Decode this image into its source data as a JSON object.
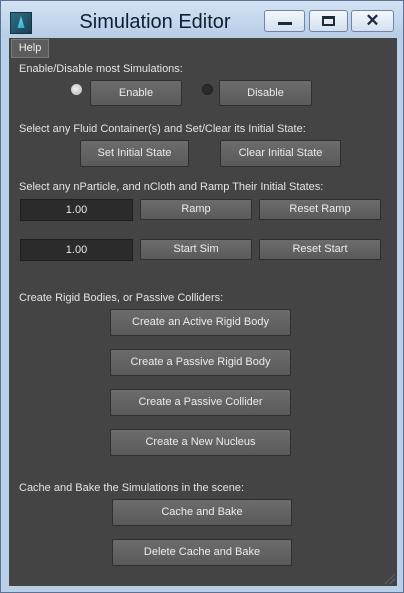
{
  "window": {
    "title": "Simulation Editor"
  },
  "menu": {
    "help": "Help"
  },
  "sections": {
    "toggle": {
      "heading": "Enable/Disable most Simulations:",
      "enable": "Enable",
      "disable": "Disable",
      "selected": "enable"
    },
    "fluid": {
      "heading": "Select any Fluid Container(s) and Set/Clear its Initial State:",
      "set": "Set Initial State",
      "clear": "Clear Initial State"
    },
    "ramp": {
      "heading": "Select any nParticle, and nCloth and Ramp Their Initial States:",
      "ramp_value": "1.00",
      "ramp": "Ramp",
      "reset_ramp": "Reset Ramp",
      "start_value": "1.00",
      "start_sim": "Start Sim",
      "reset_start": "Reset Start"
    },
    "rigid": {
      "heading": "Create Rigid Bodies, or Passive Colliders:",
      "active": "Create an Active Rigid Body",
      "passive": "Create a Passive Rigid Body",
      "collider": "Create a Passive Collider",
      "nucleus": "Create a New Nucleus"
    },
    "cache": {
      "heading": "Cache and Bake the Simulations in the scene:",
      "bake": "Cache and Bake",
      "delete": "Delete Cache and Bake"
    }
  }
}
